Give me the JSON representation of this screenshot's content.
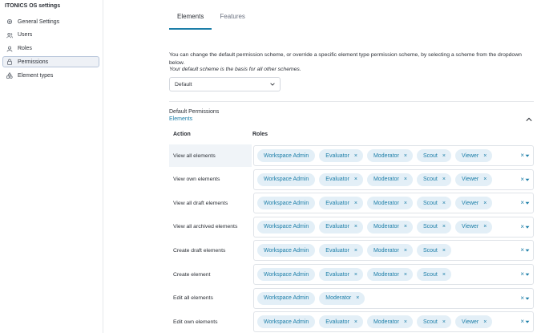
{
  "app": {
    "title": "ITONICS OS settings"
  },
  "sidebar": {
    "items": [
      {
        "label": "General Settings",
        "icon": "gear-icon",
        "active": false
      },
      {
        "label": "Users",
        "icon": "users-icon",
        "active": false
      },
      {
        "label": "Roles",
        "icon": "user-icon",
        "active": false
      },
      {
        "label": "Permissions",
        "icon": "lock-icon",
        "active": true
      },
      {
        "label": "Element types",
        "icon": "shapes-icon",
        "active": false
      }
    ]
  },
  "tabs": [
    {
      "label": "Elements",
      "active": true
    },
    {
      "label": "Features",
      "active": false
    }
  ],
  "description": "You can change the default permission scheme, or override a specific element type permission scheme, by selecting a scheme from the dropdown below.",
  "description_note": "Your default scheme is the basis for all other schemes.",
  "scheme_select": {
    "value": "Default"
  },
  "section": {
    "title": "Default Permissions",
    "link": "Elements"
  },
  "table": {
    "headers": {
      "action": "Action",
      "roles": "Roles"
    },
    "rows": [
      {
        "action": "View all elements",
        "highlight": true,
        "roles": [
          "Workspace Admin",
          "Evaluator",
          "Moderator",
          "Scout",
          "Viewer"
        ]
      },
      {
        "action": "View own elements",
        "highlight": false,
        "roles": [
          "Workspace Admin",
          "Evaluator",
          "Moderator",
          "Scout",
          "Viewer"
        ]
      },
      {
        "action": "View all draft elements",
        "highlight": false,
        "roles": [
          "Workspace Admin",
          "Evaluator",
          "Moderator",
          "Scout",
          "Viewer"
        ]
      },
      {
        "action": "View all archived elements",
        "highlight": false,
        "roles": [
          "Workspace Admin",
          "Evaluator",
          "Moderator",
          "Scout",
          "Viewer"
        ]
      },
      {
        "action": "Create draft elements",
        "highlight": false,
        "roles": [
          "Workspace Admin",
          "Evaluator",
          "Moderator",
          "Scout"
        ]
      },
      {
        "action": "Create element",
        "highlight": false,
        "roles": [
          "Workspace Admin",
          "Evaluator",
          "Moderator",
          "Scout"
        ]
      },
      {
        "action": "Edit all elements",
        "highlight": false,
        "roles": [
          "Workspace Admin",
          "Moderator"
        ]
      },
      {
        "action": "Edit own elements",
        "highlight": false,
        "roles": [
          "Workspace Admin",
          "Evaluator",
          "Moderator",
          "Scout",
          "Viewer"
        ]
      }
    ]
  },
  "glyphs": {
    "remove": "×",
    "clear_all": "×"
  },
  "colors": {
    "accent": "#1c7ea8",
    "chip_bg": "#e3eff7",
    "active_nav_bg": "#eef1f6",
    "row_highlight": "#f0f4f8"
  }
}
